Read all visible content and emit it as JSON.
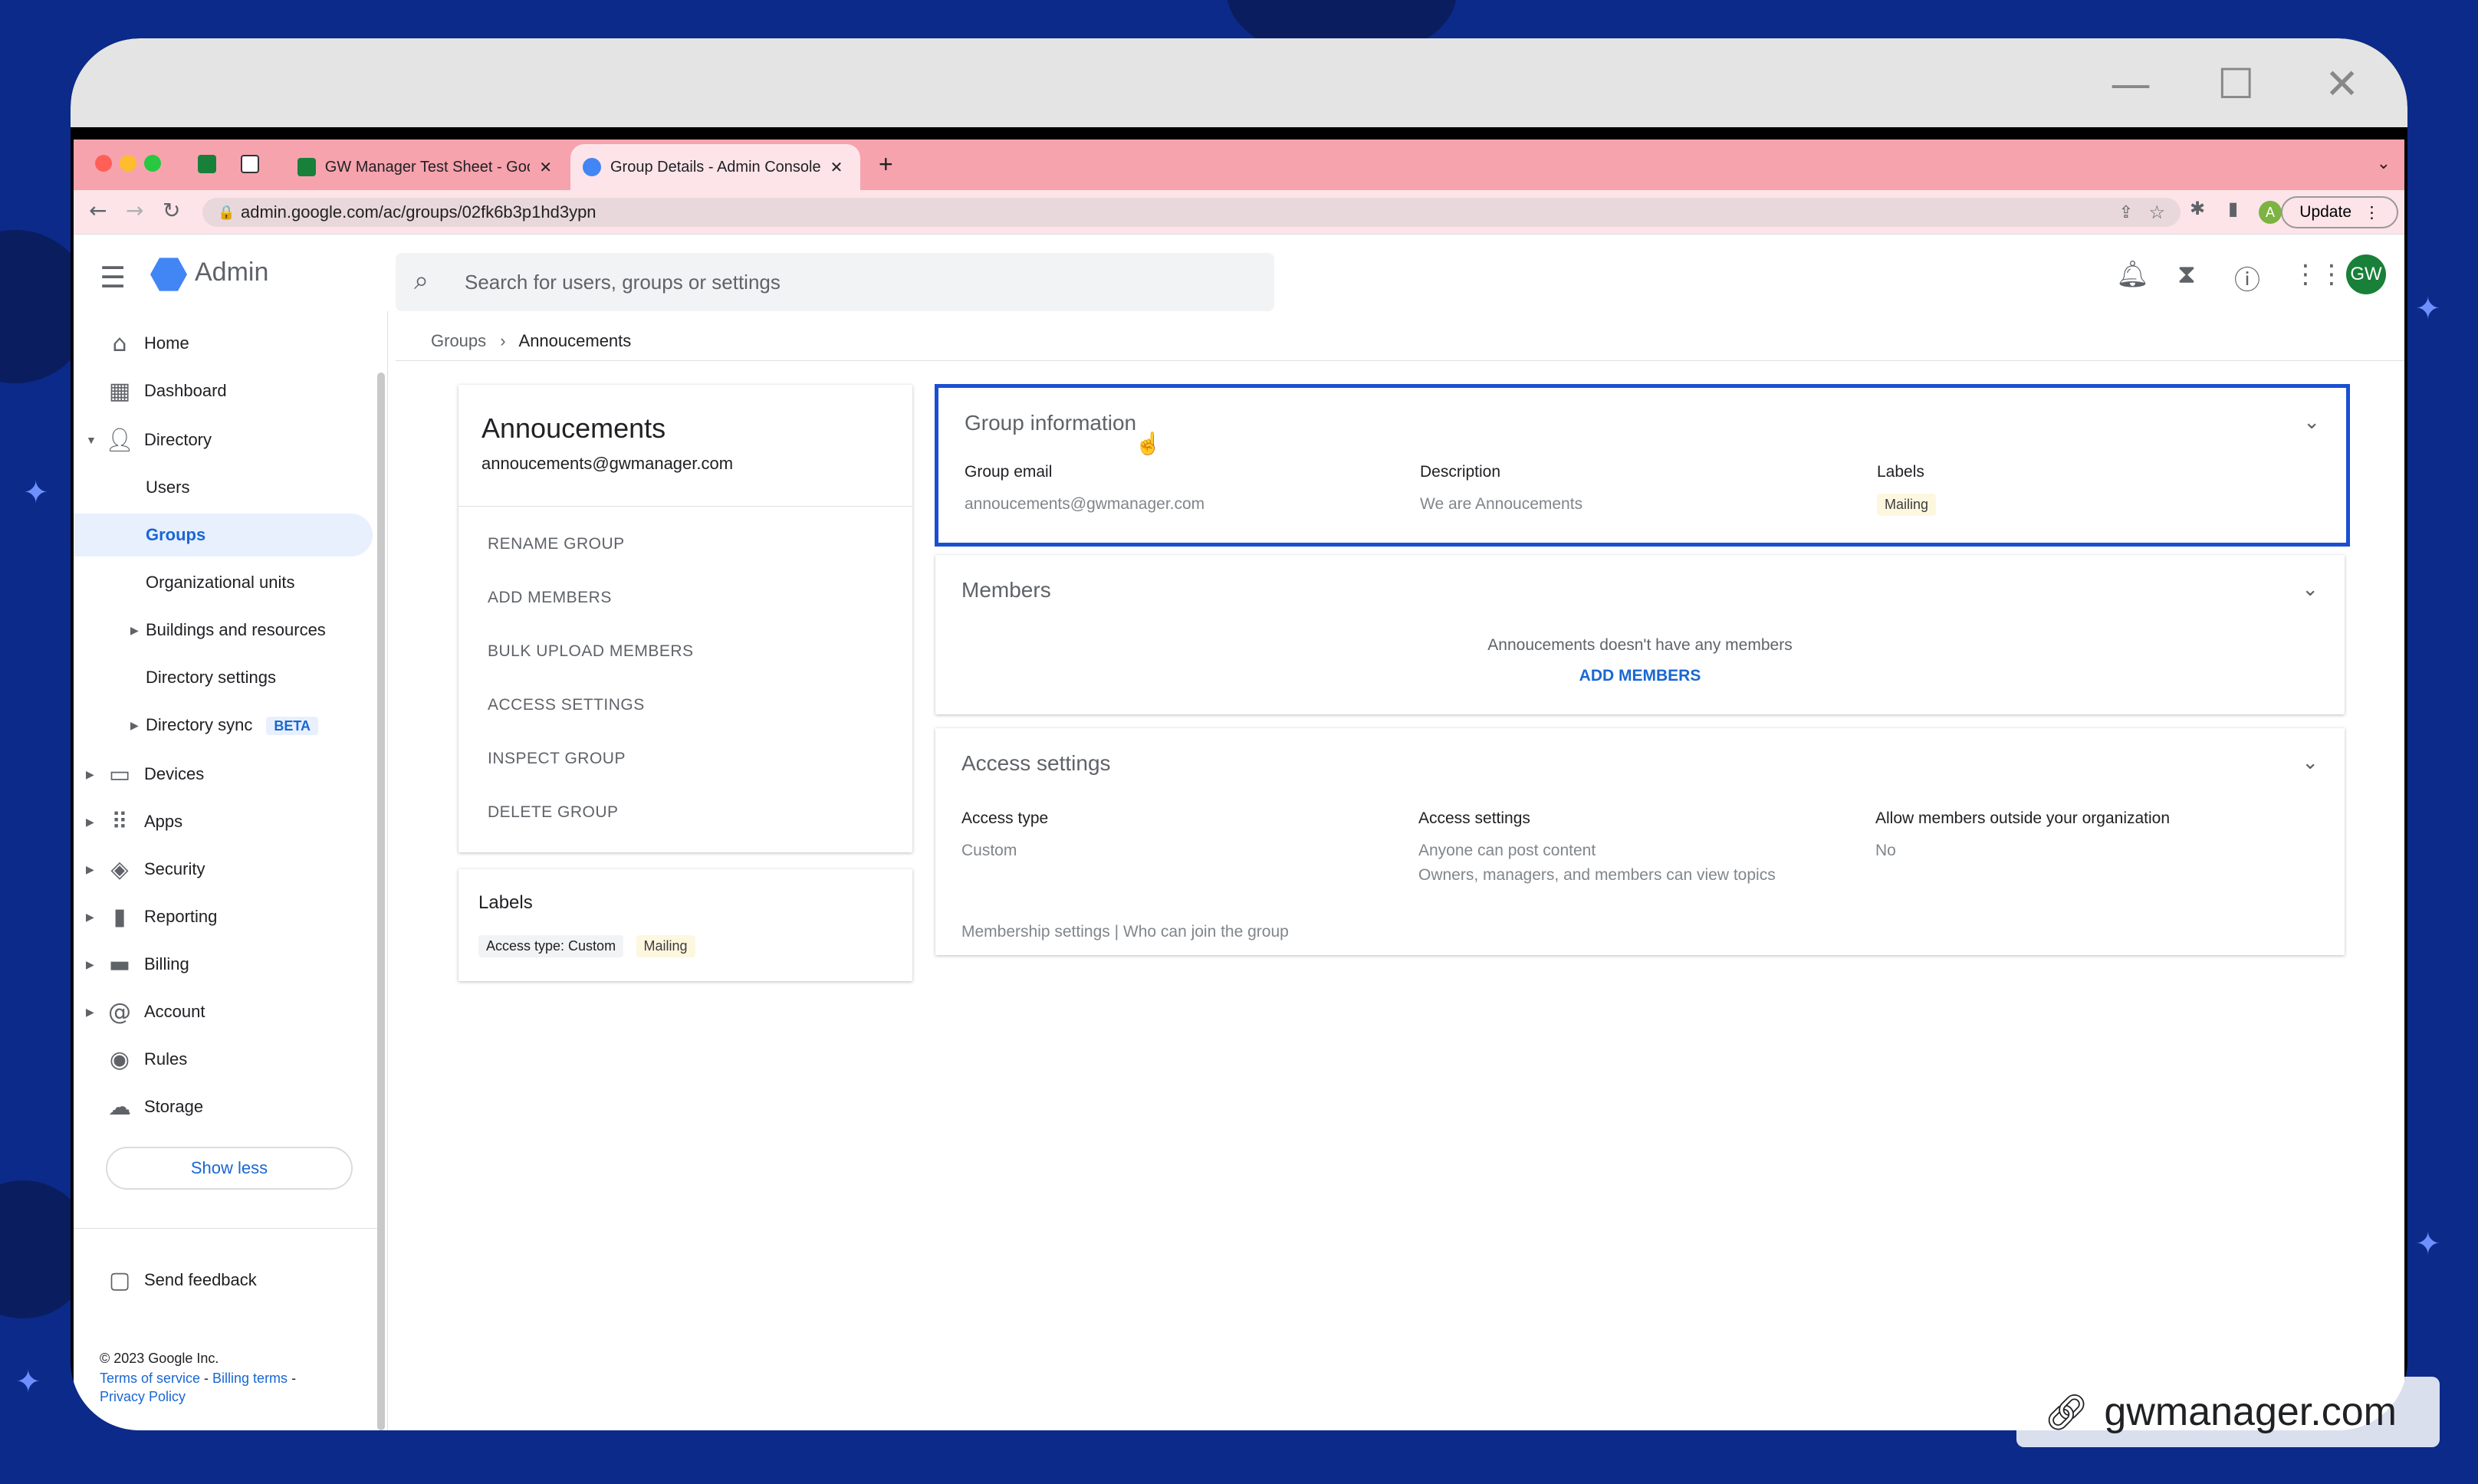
{
  "os_window": {
    "controls": [
      "—",
      "☐",
      "✕"
    ]
  },
  "browser": {
    "tabs": [
      {
        "label": "GW Manager Test Sheet - Goo",
        "active": false
      },
      {
        "label": "Group Details - Admin Console",
        "active": true
      }
    ],
    "url": "admin.google.com/ac/groups/02fk6b3p1hd3ypn",
    "profile_initial": "A",
    "update_label": "Update"
  },
  "app": {
    "product": "Admin",
    "search_placeholder": "Search for users, groups or settings",
    "avatar_initials": "GW"
  },
  "sidebar": {
    "items": [
      {
        "label": "Home",
        "icon": "home-icon"
      },
      {
        "label": "Dashboard",
        "icon": "dashboard-icon"
      },
      {
        "label": "Directory",
        "icon": "person-icon"
      },
      {
        "label": "Users"
      },
      {
        "label": "Groups"
      },
      {
        "label": "Organizational units"
      },
      {
        "label": "Buildings and resources"
      },
      {
        "label": "Directory settings"
      },
      {
        "label": "Directory sync",
        "badge": "BETA"
      },
      {
        "label": "Devices",
        "icon": "devices-icon"
      },
      {
        "label": "Apps",
        "icon": "apps-icon"
      },
      {
        "label": "Security",
        "icon": "shield-icon"
      },
      {
        "label": "Reporting",
        "icon": "bar-chart-icon"
      },
      {
        "label": "Billing",
        "icon": "credit-card-icon"
      },
      {
        "label": "Account",
        "icon": "at-icon"
      },
      {
        "label": "Rules",
        "icon": "rules-icon"
      },
      {
        "label": "Storage",
        "icon": "cloud-icon"
      }
    ],
    "show_less": "Show less",
    "send_feedback": "Send feedback",
    "copyright": "© 2023 Google Inc.",
    "terms": "Terms of service",
    "billing_terms": "Billing terms",
    "privacy": "Privacy Policy"
  },
  "breadcrumb": {
    "parent": "Groups",
    "current": "Annoucements"
  },
  "group": {
    "name": "Annoucements",
    "email": "annoucements@gwmanager.com",
    "actions": [
      "RENAME GROUP",
      "ADD MEMBERS",
      "BULK UPLOAD MEMBERS",
      "ACCESS SETTINGS",
      "INSPECT GROUP",
      "DELETE GROUP"
    ],
    "labels_title": "Labels",
    "label_chips": [
      "Access type: Custom",
      "Mailing"
    ]
  },
  "group_information": {
    "title": "Group information",
    "email_label": "Group email",
    "email_value": "annoucements@gwmanager.com",
    "description_label": "Description",
    "description_value": "We are Annoucements",
    "labels_label": "Labels",
    "labels_value": "Mailing"
  },
  "members": {
    "title": "Members",
    "empty_text": "Annoucements doesn't have any members",
    "add_label": "ADD MEMBERS"
  },
  "access": {
    "title": "Access settings",
    "type_label": "Access type",
    "type_value": "Custom",
    "settings_label": "Access settings",
    "settings_line1": "Anyone can post content",
    "settings_line2": "Owners, managers, and members can view topics",
    "outside_label": "Allow members outside your organization",
    "outside_value": "No",
    "footer": "Membership settings | Who can join the group"
  },
  "watermark": "gwmanager.com"
}
